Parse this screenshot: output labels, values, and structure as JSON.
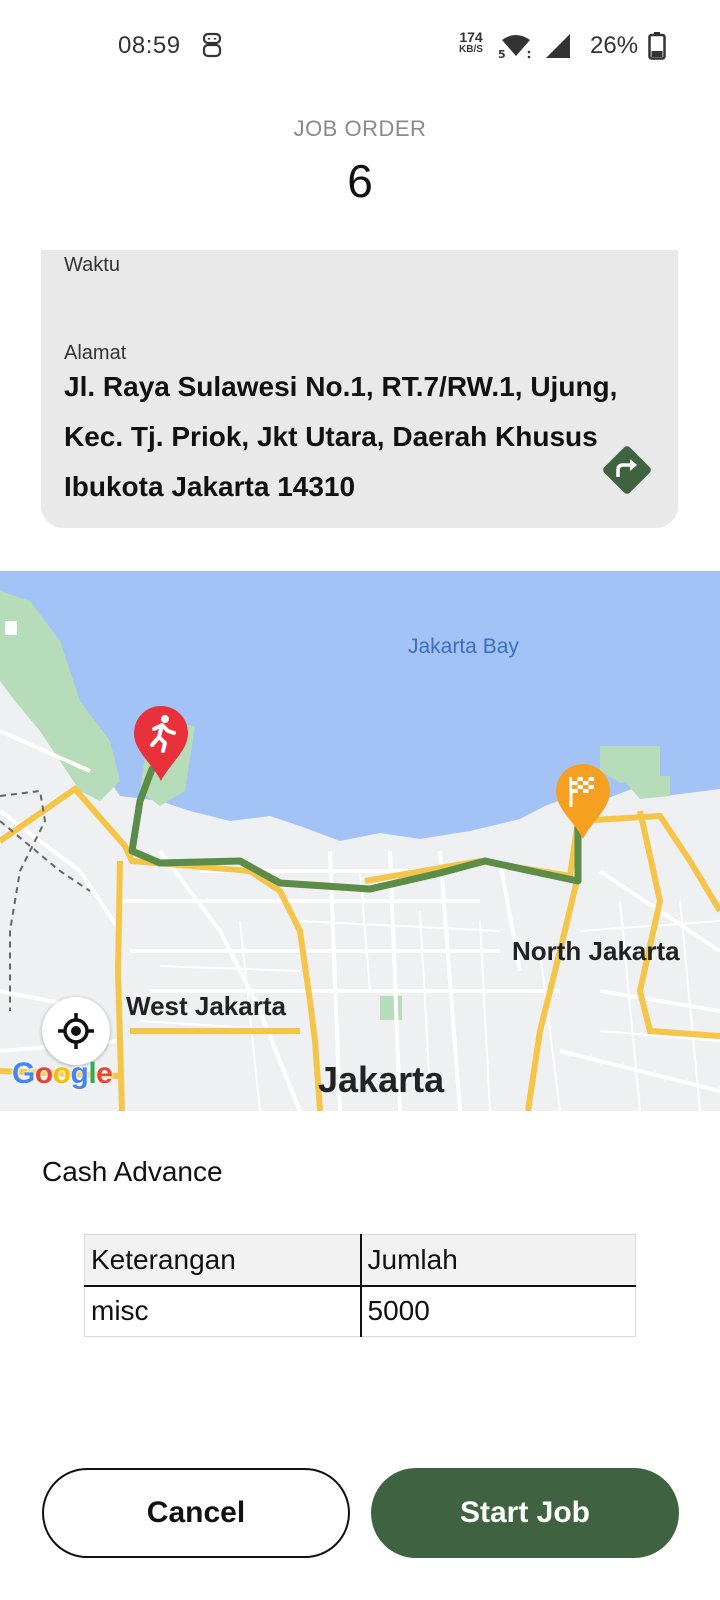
{
  "status_bar": {
    "time": "08:59",
    "net_speed": "174",
    "net_unit": "KB/S",
    "battery": "26%"
  },
  "header": {
    "label": "JOB ORDER",
    "number": "6"
  },
  "info_card": {
    "waktu_label": "Waktu",
    "alamat_label": "Alamat",
    "alamat_value": "Jl. Raya Sulawesi No.1, RT.7/RW.1, Ujung, Kec. Tj. Priok, Jkt Utara, Daerah Khusus Ibukota Jakarta 14310",
    "directions_icon": "directions-icon"
  },
  "map": {
    "labels": {
      "bay": "Jakarta Bay",
      "north": "North Jakarta",
      "west": "West Jakarta",
      "city": "Jakarta"
    },
    "google_logo": "Google",
    "colors": {
      "water": "#a3c3f7",
      "route": "#5b8c48",
      "start_pin": "#e8313a",
      "end_pin": "#f6a021"
    }
  },
  "cash_advance": {
    "title": "Cash Advance",
    "columns": [
      "Keterangan",
      "Jumlah"
    ],
    "rows": [
      [
        "misc",
        "5000"
      ]
    ]
  },
  "buttons": {
    "cancel": "Cancel",
    "start": "Start Job"
  },
  "colors": {
    "primary": "#3f6340",
    "card_bg": "#e9e9e9"
  }
}
